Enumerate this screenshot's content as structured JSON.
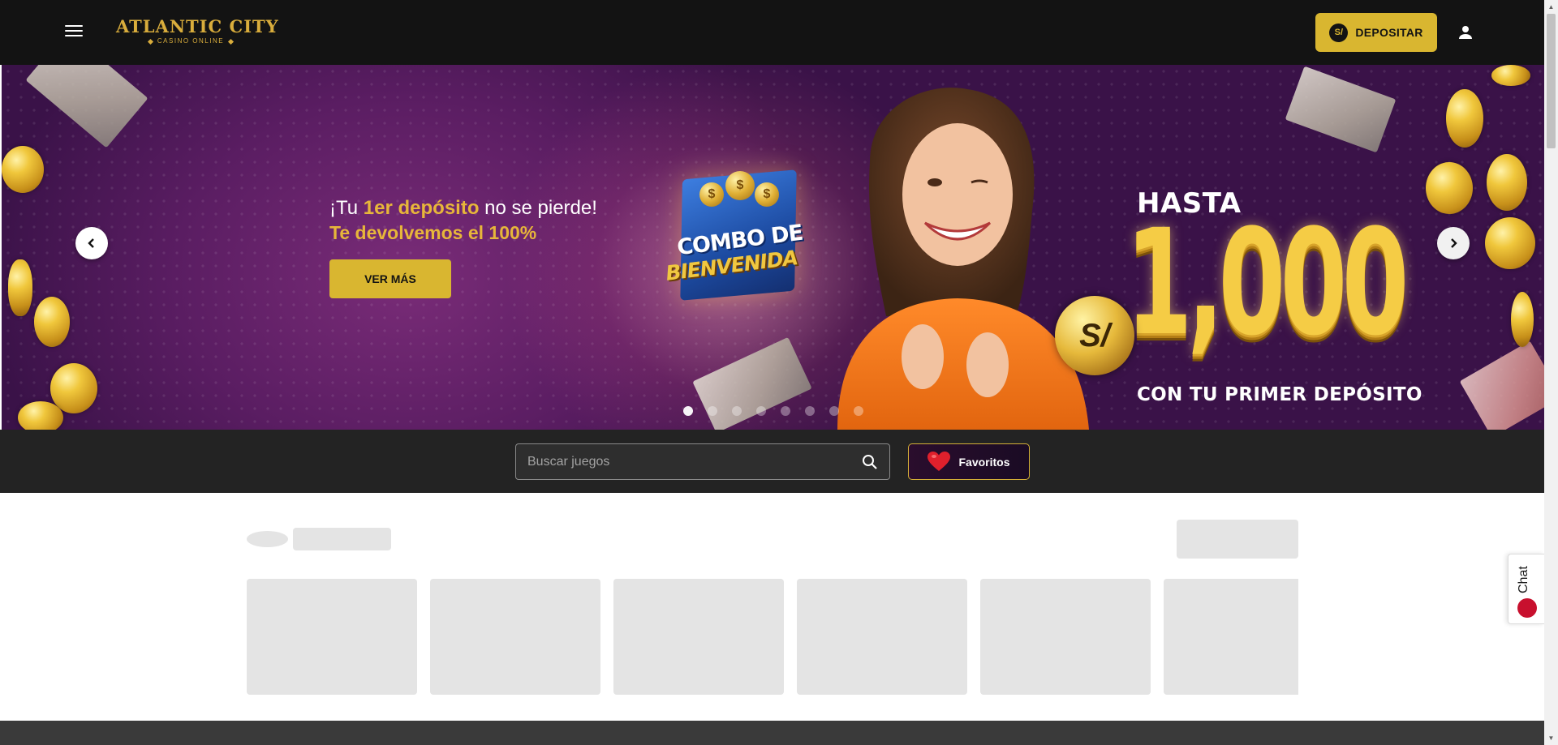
{
  "header": {
    "logo": {
      "main": "ATLANTIC CITY",
      "sub": "CASINO ONLINE"
    },
    "deposit_button": {
      "currency_symbol": "S/",
      "label": "DEPOSITAR"
    },
    "icons": {
      "menu": "hamburger-menu-icon",
      "user": "user-account-icon"
    }
  },
  "banner": {
    "promo_line1_prefix": "¡Tu ",
    "promo_line1_highlight": "1er depósito",
    "promo_line1_suffix": " no se pierde!",
    "promo_line2": "Te devolvemos el 100%",
    "cta_label": "VER MÁS",
    "combo_line1": "COMBO DE",
    "combo_line2": "BIENVENIDA",
    "combo_coin_symbol": "$",
    "hasta": "HASTA",
    "coin_symbol": "S/",
    "amount": "1,000",
    "tagline": "CON TU PRIMER DEPÓSITO",
    "slide_count": 8,
    "active_slide": 1,
    "accent_gold": "#d9b630"
  },
  "search": {
    "placeholder": "Buscar juegos",
    "favorites_label": "Favoritos",
    "icons": {
      "search": "search-icon",
      "favorites": "heart-icon"
    }
  },
  "chat_widget": {
    "label": "Chat"
  },
  "colors": {
    "header_bg": "#131313",
    "search_strip_bg": "#232323",
    "skeleton": "#e4e4e4",
    "gold": "#d9b630"
  }
}
